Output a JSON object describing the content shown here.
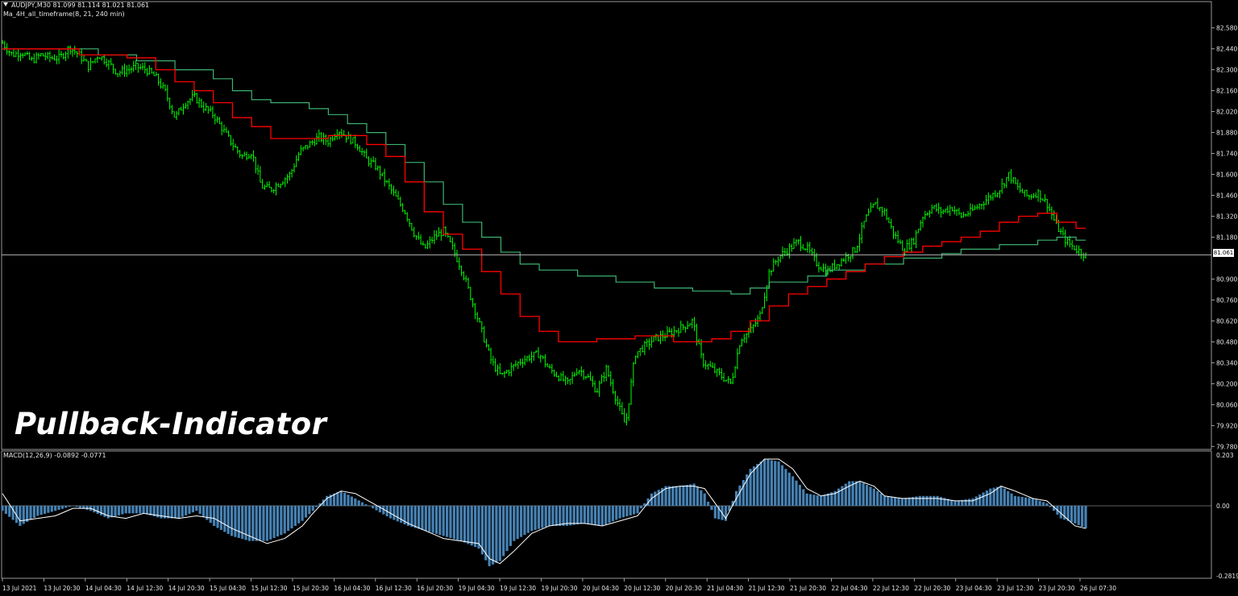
{
  "header": {
    "symbol_line": "AUDJPY,M30  81.099 81.114 81.021 81.061",
    "indicator_line": "Ma_4H_all_timeframe(8, 21, 240 min)"
  },
  "watermark": "Pullback-Indicator",
  "current_price_label": "81.061",
  "macd_panel": {
    "label": "MACD(12,26,9) -0.0892 -0.0771"
  },
  "colors": {
    "background": "#000000",
    "candles": "#00ff00",
    "ma_fast": "#ff0000",
    "ma_slow": "#3cb371",
    "macd_hist": "#4682b4",
    "signal_line": "#ffffff",
    "grid_axis": "#c0c0c0"
  },
  "chart_data": [
    {
      "type": "line",
      "name": "AUDJPY M30 price",
      "y_ticks": [
        "82.580",
        "82.440",
        "82.300",
        "82.160",
        "82.020",
        "81.880",
        "81.740",
        "81.600",
        "81.460",
        "81.320",
        "81.180",
        "80.900",
        "80.760",
        "80.620",
        "80.480",
        "80.340",
        "80.200",
        "80.060",
        "79.920",
        "79.780"
      ],
      "x_ticks": [
        "13 Jul 2021",
        "13 Jul 20:30",
        "14 Jul 04:30",
        "14 Jul 12:30",
        "14 Jul 20:30",
        "15 Jul 04:30",
        "15 Jul 12:30",
        "15 Jul 20:30",
        "16 Jul 04:30",
        "16 Jul 12:30",
        "16 Jul 20:30",
        "19 Jul 04:30",
        "19 Jul 12:30",
        "19 Jul 20:30",
        "20 Jul 04:30",
        "20 Jul 12:30",
        "20 Jul 20:30",
        "21 Jul 04:30",
        "21 Jul 12:30",
        "21 Jul 20:30",
        "22 Jul 04:30",
        "22 Jul 12:30",
        "22 Jul 20:30",
        "23 Jul 04:30",
        "23 Jul 12:30",
        "23 Jul 20:30",
        "26 Jul 07:30"
      ],
      "ylim": [
        79.76,
        82.67
      ],
      "current_price": 81.061,
      "price_path": [
        [
          0,
          82.48
        ],
        [
          1,
          82.4
        ],
        [
          2,
          82.42
        ],
        [
          3,
          82.36
        ],
        [
          4,
          82.4
        ],
        [
          5,
          82.38
        ],
        [
          6,
          82.38
        ],
        [
          7,
          82.45
        ],
        [
          8,
          82.4
        ],
        [
          9,
          82.32
        ],
        [
          10,
          82.4
        ],
        [
          11,
          82.35
        ],
        [
          12,
          82.28
        ],
        [
          13,
          82.3
        ],
        [
          14,
          82.32
        ],
        [
          15,
          82.3
        ],
        [
          16,
          82.25
        ],
        [
          17,
          82.15
        ],
        [
          18,
          81.98
        ],
        [
          19,
          82.08
        ],
        [
          20,
          82.12
        ],
        [
          21,
          82.05
        ],
        [
          22,
          82.0
        ],
        [
          23,
          81.9
        ],
        [
          24,
          81.8
        ],
        [
          25,
          81.72
        ],
        [
          26,
          81.75
        ],
        [
          27,
          81.52
        ],
        [
          28,
          81.5
        ],
        [
          29,
          81.55
        ],
        [
          30,
          81.6
        ],
        [
          31,
          81.75
        ],
        [
          32,
          81.8
        ],
        [
          33,
          81.85
        ],
        [
          34,
          81.82
        ],
        [
          35,
          81.9
        ],
        [
          36,
          81.85
        ],
        [
          37,
          81.8
        ],
        [
          38,
          81.7
        ],
        [
          39,
          81.65
        ],
        [
          40,
          81.55
        ],
        [
          41,
          81.45
        ],
        [
          42,
          81.35
        ],
        [
          43,
          81.2
        ],
        [
          44,
          81.1
        ],
        [
          45,
          81.18
        ],
        [
          46,
          81.22
        ],
        [
          47,
          81.1
        ],
        [
          48,
          80.95
        ],
        [
          49,
          80.75
        ],
        [
          50,
          80.55
        ],
        [
          51,
          80.35
        ],
        [
          52,
          80.25
        ],
        [
          53,
          80.3
        ],
        [
          54,
          80.35
        ],
        [
          55,
          80.38
        ],
        [
          56,
          80.4
        ],
        [
          57,
          80.3
        ],
        [
          58,
          80.25
        ],
        [
          59,
          80.2
        ],
        [
          60,
          80.3
        ],
        [
          61,
          80.25
        ],
        [
          62,
          80.15
        ],
        [
          63,
          80.3
        ],
        [
          64,
          80.1
        ],
        [
          65,
          79.92
        ],
        [
          66,
          80.4
        ],
        [
          67,
          80.45
        ],
        [
          68,
          80.5
        ],
        [
          69,
          80.52
        ],
        [
          70,
          80.55
        ],
        [
          71,
          80.58
        ],
        [
          72,
          80.62
        ],
        [
          73,
          80.35
        ],
        [
          74,
          80.3
        ],
        [
          75,
          80.25
        ],
        [
          76,
          80.2
        ],
        [
          77,
          80.5
        ],
        [
          78,
          80.55
        ],
        [
          79,
          80.65
        ],
        [
          80,
          80.95
        ],
        [
          81,
          81.05
        ],
        [
          82,
          81.1
        ],
        [
          83,
          81.15
        ],
        [
          84,
          81.1
        ],
        [
          85,
          81.0
        ],
        [
          86,
          80.95
        ],
        [
          87,
          81.0
        ],
        [
          88,
          81.05
        ],
        [
          89,
          81.1
        ],
        [
          90,
          81.3
        ],
        [
          91,
          81.4
        ],
        [
          92,
          81.35
        ],
        [
          93,
          81.2
        ],
        [
          94,
          81.1
        ],
        [
          95,
          81.15
        ],
        [
          96,
          81.32
        ],
        [
          97,
          81.38
        ],
        [
          98,
          81.35
        ],
        [
          99,
          81.38
        ],
        [
          100,
          81.32
        ],
        [
          101,
          81.35
        ],
        [
          102,
          81.4
        ],
        [
          103,
          81.45
        ],
        [
          104,
          81.5
        ],
        [
          105,
          81.6
        ],
        [
          106,
          81.5
        ],
        [
          107,
          81.45
        ],
        [
          108,
          81.48
        ],
        [
          109,
          81.4
        ],
        [
          110,
          81.25
        ],
        [
          111,
          81.15
        ],
        [
          112,
          81.1
        ],
        [
          113,
          81.06
        ]
      ],
      "ma_fast_steps": [
        [
          0,
          82.44
        ],
        [
          8,
          82.4
        ],
        [
          13,
          82.38
        ],
        [
          16,
          82.3
        ],
        [
          18,
          82.22
        ],
        [
          20,
          82.16
        ],
        [
          22,
          82.08
        ],
        [
          24,
          81.98
        ],
        [
          26,
          81.92
        ],
        [
          28,
          81.84
        ],
        [
          34,
          81.86
        ],
        [
          38,
          81.8
        ],
        [
          40,
          81.72
        ],
        [
          42,
          81.55
        ],
        [
          44,
          81.35
        ],
        [
          46,
          81.2
        ],
        [
          48,
          81.1
        ],
        [
          50,
          80.95
        ],
        [
          52,
          80.8
        ],
        [
          54,
          80.65
        ],
        [
          56,
          80.55
        ],
        [
          58,
          80.48
        ],
        [
          62,
          80.5
        ],
        [
          66,
          80.52
        ],
        [
          70,
          80.48
        ],
        [
          74,
          80.5
        ],
        [
          76,
          80.55
        ],
        [
          78,
          80.62
        ],
        [
          80,
          80.72
        ],
        [
          82,
          80.8
        ],
        [
          84,
          80.85
        ],
        [
          86,
          80.9
        ],
        [
          88,
          80.95
        ],
        [
          90,
          81.0
        ],
        [
          92,
          81.05
        ],
        [
          94,
          81.08
        ],
        [
          96,
          81.12
        ],
        [
          98,
          81.15
        ],
        [
          100,
          81.18
        ],
        [
          102,
          81.22
        ],
        [
          104,
          81.28
        ],
        [
          106,
          81.32
        ],
        [
          108,
          81.34
        ],
        [
          110,
          81.28
        ],
        [
          112,
          81.24
        ]
      ],
      "ma_slow_steps": [
        [
          0,
          82.44
        ],
        [
          10,
          82.4
        ],
        [
          14,
          82.36
        ],
        [
          18,
          82.3
        ],
        [
          22,
          82.24
        ],
        [
          24,
          82.16
        ],
        [
          26,
          82.1
        ],
        [
          28,
          82.08
        ],
        [
          32,
          82.04
        ],
        [
          34,
          82.0
        ],
        [
          36,
          81.94
        ],
        [
          38,
          81.88
        ],
        [
          40,
          81.8
        ],
        [
          42,
          81.68
        ],
        [
          44,
          81.55
        ],
        [
          46,
          81.4
        ],
        [
          48,
          81.28
        ],
        [
          50,
          81.18
        ],
        [
          52,
          81.08
        ],
        [
          54,
          81.0
        ],
        [
          56,
          80.96
        ],
        [
          60,
          80.92
        ],
        [
          64,
          80.88
        ],
        [
          68,
          80.84
        ],
        [
          72,
          80.82
        ],
        [
          76,
          80.8
        ],
        [
          78,
          80.84
        ],
        [
          80,
          80.88
        ],
        [
          84,
          80.92
        ],
        [
          86,
          80.96
        ],
        [
          90,
          81.0
        ],
        [
          94,
          81.04
        ],
        [
          98,
          81.07
        ],
        [
          100,
          81.1
        ],
        [
          104,
          81.13
        ],
        [
          108,
          81.16
        ],
        [
          110,
          81.18
        ],
        [
          112,
          81.16
        ]
      ]
    },
    {
      "type": "bar",
      "name": "MACD(12,26,9)",
      "y_ticks": [
        "0.203",
        "0.00",
        "-0.2819"
      ],
      "ylim": [
        -0.2819,
        0.203
      ],
      "macd": -0.0892,
      "signal": -0.0771,
      "hist_path": [
        [
          0,
          -0.02
        ],
        [
          5,
          -0.08
        ],
        [
          10,
          -0.04
        ],
        [
          15,
          -0.02
        ],
        [
          20,
          0.0
        ],
        [
          25,
          -0.02
        ],
        [
          30,
          -0.05
        ],
        [
          35,
          -0.03
        ],
        [
          40,
          -0.03
        ],
        [
          45,
          -0.05
        ],
        [
          50,
          -0.05
        ],
        [
          55,
          -0.02
        ],
        [
          60,
          -0.08
        ],
        [
          65,
          -0.12
        ],
        [
          70,
          -0.14
        ],
        [
          75,
          -0.14
        ],
        [
          80,
          -0.11
        ],
        [
          85,
          -0.06
        ],
        [
          88,
          -0.02
        ],
        [
          92,
          0.04
        ],
        [
          96,
          0.06
        ],
        [
          100,
          0.03
        ],
        [
          105,
          -0.01
        ],
        [
          110,
          -0.05
        ],
        [
          115,
          -0.08
        ],
        [
          120,
          -0.1
        ],
        [
          125,
          -0.12
        ],
        [
          130,
          -0.14
        ],
        [
          135,
          -0.17
        ],
        [
          138,
          -0.24
        ],
        [
          141,
          -0.22
        ],
        [
          145,
          -0.14
        ],
        [
          150,
          -0.1
        ],
        [
          155,
          -0.08
        ],
        [
          160,
          -0.08
        ],
        [
          165,
          -0.07
        ],
        [
          170,
          -0.08
        ],
        [
          175,
          -0.05
        ],
        [
          180,
          -0.03
        ],
        [
          184,
          0.05
        ],
        [
          188,
          0.08
        ],
        [
          192,
          0.08
        ],
        [
          196,
          0.09
        ],
        [
          199,
          0.05
        ],
        [
          202,
          -0.05
        ],
        [
          205,
          -0.06
        ],
        [
          208,
          0.06
        ],
        [
          212,
          0.15
        ],
        [
          216,
          0.19
        ],
        [
          220,
          0.18
        ],
        [
          224,
          0.12
        ],
        [
          228,
          0.05
        ],
        [
          232,
          0.04
        ],
        [
          236,
          0.06
        ],
        [
          240,
          0.1
        ],
        [
          243,
          0.1
        ],
        [
          247,
          0.07
        ],
        [
          250,
          0.04
        ],
        [
          255,
          0.03
        ],
        [
          260,
          0.04
        ],
        [
          265,
          0.04
        ],
        [
          270,
          0.02
        ],
        [
          275,
          0.03
        ],
        [
          280,
          0.07
        ],
        [
          283,
          0.08
        ],
        [
          287,
          0.04
        ],
        [
          292,
          0.03
        ],
        [
          296,
          0.01
        ],
        [
          300,
          -0.05
        ],
        [
          304,
          -0.07
        ],
        [
          307,
          -0.09
        ]
      ],
      "signal_path": [
        [
          0,
          0.05
        ],
        [
          5,
          -0.06
        ],
        [
          10,
          -0.05
        ],
        [
          15,
          -0.04
        ],
        [
          20,
          -0.01
        ],
        [
          25,
          -0.01
        ],
        [
          30,
          -0.04
        ],
        [
          35,
          -0.05
        ],
        [
          40,
          -0.03
        ],
        [
          45,
          -0.04
        ],
        [
          50,
          -0.05
        ],
        [
          55,
          -0.04
        ],
        [
          60,
          -0.05
        ],
        [
          65,
          -0.09
        ],
        [
          70,
          -0.12
        ],
        [
          75,
          -0.15
        ],
        [
          80,
          -0.13
        ],
        [
          85,
          -0.08
        ],
        [
          88,
          -0.03
        ],
        [
          92,
          0.03
        ],
        [
          96,
          0.06
        ],
        [
          100,
          0.05
        ],
        [
          105,
          0.01
        ],
        [
          110,
          -0.03
        ],
        [
          115,
          -0.07
        ],
        [
          120,
          -0.1
        ],
        [
          125,
          -0.13
        ],
        [
          130,
          -0.14
        ],
        [
          135,
          -0.15
        ],
        [
          138,
          -0.21
        ],
        [
          141,
          -0.23
        ],
        [
          145,
          -0.18
        ],
        [
          150,
          -0.11
        ],
        [
          155,
          -0.08
        ],
        [
          160,
          -0.07
        ],
        [
          165,
          -0.07
        ],
        [
          170,
          -0.08
        ],
        [
          175,
          -0.06
        ],
        [
          180,
          -0.04
        ],
        [
          184,
          0.03
        ],
        [
          188,
          0.07
        ],
        [
          192,
          0.08
        ],
        [
          196,
          0.08
        ],
        [
          199,
          0.07
        ],
        [
          202,
          0.01
        ],
        [
          205,
          -0.05
        ],
        [
          208,
          0.03
        ],
        [
          212,
          0.13
        ],
        [
          216,
          0.19
        ],
        [
          220,
          0.19
        ],
        [
          224,
          0.15
        ],
        [
          228,
          0.07
        ],
        [
          232,
          0.04
        ],
        [
          236,
          0.05
        ],
        [
          240,
          0.08
        ],
        [
          243,
          0.1
        ],
        [
          247,
          0.08
        ],
        [
          250,
          0.04
        ],
        [
          255,
          0.03
        ],
        [
          260,
          0.03
        ],
        [
          265,
          0.03
        ],
        [
          270,
          0.02
        ],
        [
          275,
          0.02
        ],
        [
          280,
          0.05
        ],
        [
          283,
          0.08
        ],
        [
          287,
          0.06
        ],
        [
          292,
          0.03
        ],
        [
          296,
          0.02
        ],
        [
          300,
          -0.03
        ],
        [
          304,
          -0.08
        ],
        [
          307,
          -0.09
        ]
      ]
    }
  ]
}
